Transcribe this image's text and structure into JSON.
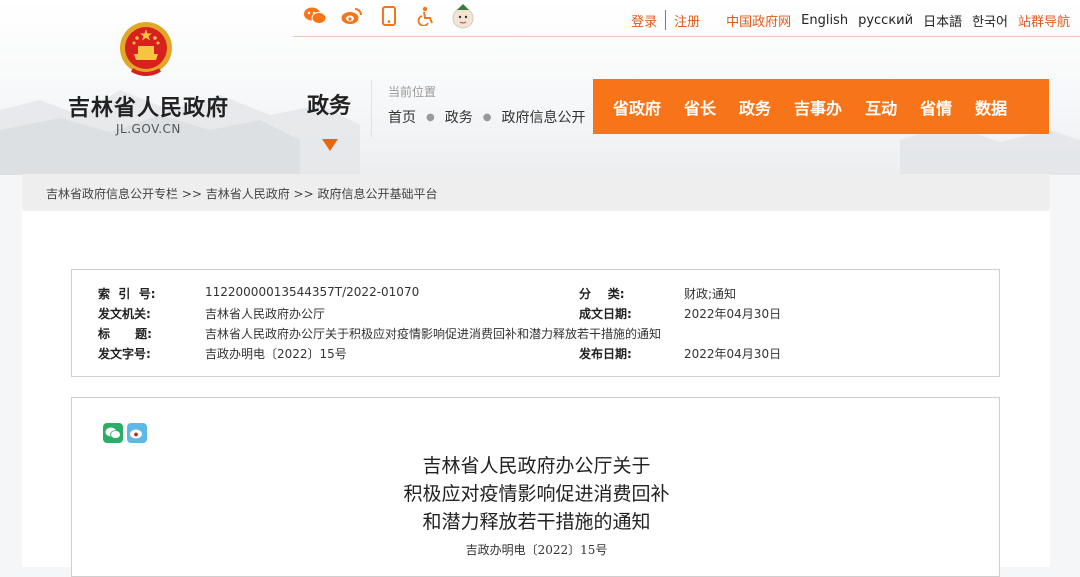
{
  "topbar": {
    "icons": [
      "weibo-chat-icon",
      "weibo-icon",
      "mobile-icon",
      "accessibility-icon",
      "mascot-icon"
    ],
    "login": "登录",
    "register": "注册",
    "gov_portal": "中国政府网",
    "english": "English",
    "russian": "русский",
    "japanese": "日本語",
    "korean": "한국어",
    "site_nav": "站群导航"
  },
  "brand": {
    "title": "吉林省人民政府",
    "domain": "JL.GOV.CN"
  },
  "section": {
    "title": "政务"
  },
  "location": {
    "label": "当前位置",
    "path": [
      "首页",
      "政务",
      "政府信息公开"
    ]
  },
  "nav": [
    "省政府",
    "省长",
    "政务",
    "吉事办",
    "互动",
    "省情",
    "数据"
  ],
  "breadcrumb": "吉林省政府信息公开专栏 >> 吉林省人民政府 >> 政府信息公开基础平台",
  "meta": {
    "index_label": "索  引  号:",
    "index_value": "11220000013544357T/2022-01070",
    "category_label": "分    类:",
    "category_value": "财政;通知",
    "issuer_label": "发文机关:",
    "issuer_value": "吉林省人民政府办公厅",
    "created_label": "成文日期:",
    "created_value": "2022年04月30日",
    "title_label": "标      题:",
    "title_value": "吉林省人民政府办公厅关于积极应对疫情影响促进消费回补和潜力释放若干措施的通知",
    "docno_label": "发文字号:",
    "docno_value": "吉政办明电〔2022〕15号",
    "published_label": "发布日期:",
    "published_value": "2022年04月30日"
  },
  "document": {
    "title_lines": [
      "吉林省人民政府办公厅关于",
      "积极应对疫情影响促进消费回补",
      "和潜力释放若干措施的通知"
    ],
    "number": "吉政办明电〔2022〕15号"
  },
  "colors": {
    "accent": "#f77418",
    "link": "#e05a1d"
  }
}
